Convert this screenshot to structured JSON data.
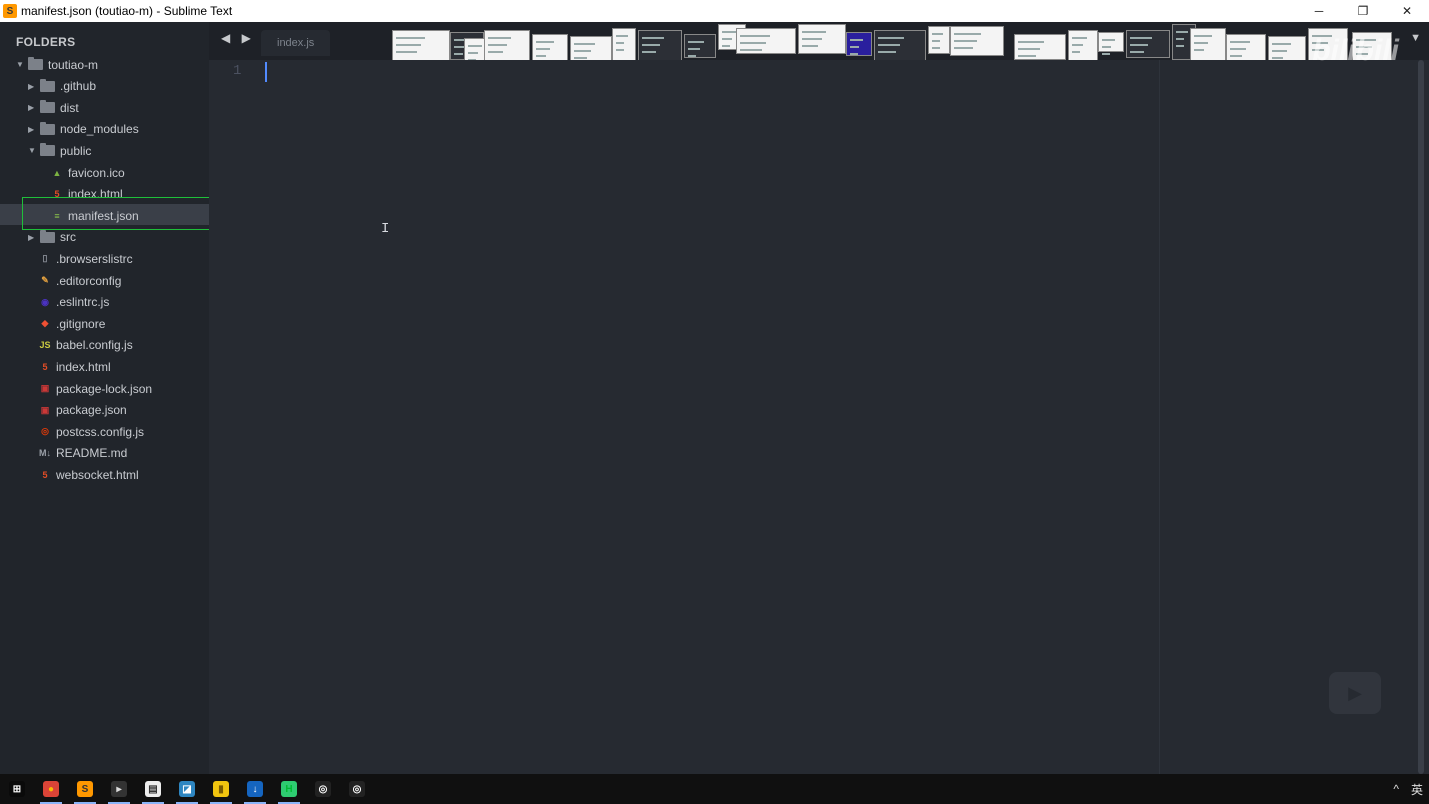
{
  "window": {
    "title": "manifest.json (toutiao-m) - Sublime Text",
    "app_icon_glyph": "S",
    "controls": {
      "minimize": "─",
      "maximize": "❐",
      "close": "✕"
    }
  },
  "sidebar": {
    "header": "FOLDERS",
    "items": [
      {
        "label": "toutiao-m",
        "arrow": "▼",
        "icon": "folder-open-icon"
      },
      {
        "label": ".github",
        "arrow": "▶",
        "icon": "folder-icon"
      },
      {
        "label": "dist",
        "arrow": "▶",
        "icon": "folder-icon"
      },
      {
        "label": "node_modules",
        "arrow": "▶",
        "icon": "folder-icon"
      },
      {
        "label": "public",
        "arrow": "▼",
        "icon": "folder-open-icon"
      },
      {
        "label": "favicon.ico",
        "arrow": "",
        "icon": "image-file-icon"
      },
      {
        "label": "index.html",
        "arrow": "",
        "icon": "html5-icon"
      },
      {
        "label": "manifest.json",
        "arrow": "",
        "icon": "json-file-icon"
      },
      {
        "label": "src",
        "arrow": "▶",
        "icon": "folder-icon"
      },
      {
        "label": ".browserslistrc",
        "arrow": "",
        "icon": "file-icon"
      },
      {
        "label": ".editorconfig",
        "arrow": "",
        "icon": "editorconfig-icon"
      },
      {
        "label": ".eslintrc.js",
        "arrow": "",
        "icon": "eslint-icon"
      },
      {
        "label": ".gitignore",
        "arrow": "",
        "icon": "git-icon"
      },
      {
        "label": "babel.config.js",
        "arrow": "",
        "icon": "js-file-icon"
      },
      {
        "label": "index.html",
        "arrow": "",
        "icon": "html5-icon"
      },
      {
        "label": "package-lock.json",
        "arrow": "",
        "icon": "npm-icon"
      },
      {
        "label": "package.json",
        "arrow": "",
        "icon": "npm-icon"
      },
      {
        "label": "postcss.config.js",
        "arrow": "",
        "icon": "postcss-icon"
      },
      {
        "label": "README.md",
        "arrow": "",
        "icon": "markdown-icon"
      },
      {
        "label": "websocket.html",
        "arrow": "",
        "icon": "html5-icon"
      }
    ],
    "selected_item": "manifest.json"
  },
  "tabs": {
    "nav_arrows": "◀ ▶",
    "items": [
      {
        "label": "index.js",
        "active": false
      }
    ],
    "dropdown": "▼"
  },
  "editor": {
    "line_numbers": [
      "1"
    ],
    "content": ""
  },
  "overlay": {
    "watermark": "bilibili"
  },
  "taskbar": {
    "apps": [
      "start-icon",
      "chrome-icon",
      "sublime-icon",
      "terminal-icon",
      "notes-icon",
      "explorer-icon",
      "files-icon",
      "download-icon",
      "hbuilder-icon",
      "obs-icon",
      "obs-icon-2"
    ],
    "tray_text": "英"
  },
  "colors": {
    "sidebar_bg": "#21252b",
    "editor_bg": "#262a31",
    "selection_bg": "#3a3f48",
    "focus_box": "#1fbf3a",
    "cursor": "#528bff"
  }
}
